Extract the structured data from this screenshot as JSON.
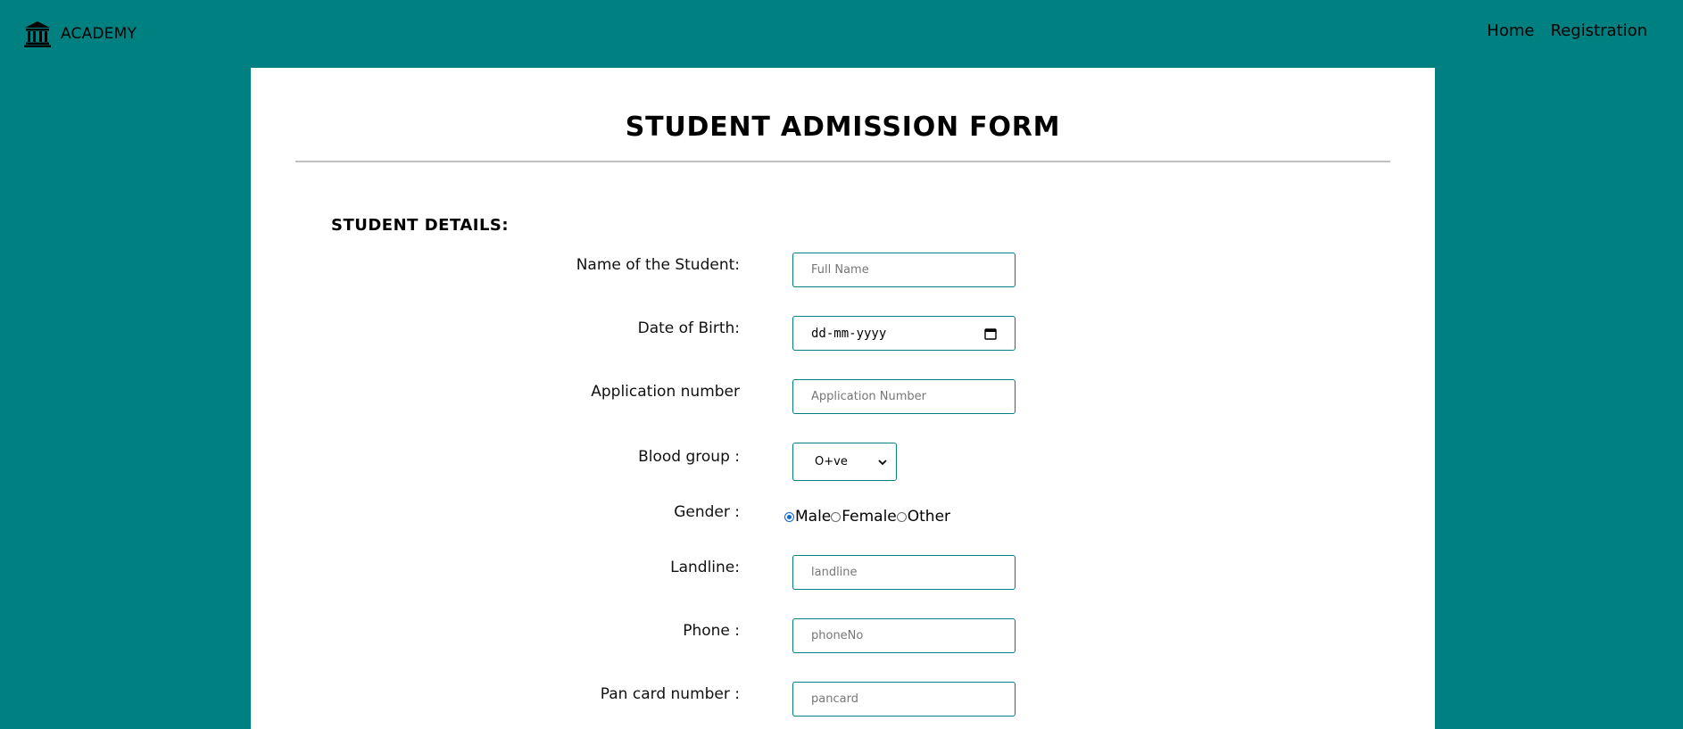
{
  "brand": {
    "icon": "museum-icon",
    "name": "ACADEMY"
  },
  "nav": {
    "links": [
      "Home",
      "Registration"
    ]
  },
  "form": {
    "title": "STUDENT ADMISSION FORM",
    "section_heading": "STUDENT DETAILS:",
    "fields": {
      "student_name": {
        "label": "Name of the Student:",
        "placeholder": "Full Name",
        "value": ""
      },
      "dob": {
        "label": "Date of Birth:",
        "display": "dd-mm-yyyy",
        "icon": "calendar-icon"
      },
      "application_number": {
        "label": "Application number",
        "placeholder": "Application Number",
        "value": ""
      },
      "blood_group": {
        "label": "Blood group :",
        "selected": "O+ve",
        "icon": "chevron-down-icon"
      },
      "gender": {
        "label": "Gender :",
        "options": [
          "Male",
          "Female",
          "Other"
        ],
        "selected": "Male"
      },
      "landline": {
        "label": "Landline:",
        "placeholder": "landline",
        "value": ""
      },
      "phone": {
        "label": "Phone :",
        "placeholder": "phoneNo",
        "value": ""
      },
      "pancard": {
        "label": "Pan card number :",
        "placeholder": "pancard",
        "value": ""
      }
    }
  },
  "colors": {
    "background": "#008080",
    "card": "#ffffff",
    "field_border": "#008080",
    "radio_selected": "#0b64d8"
  }
}
